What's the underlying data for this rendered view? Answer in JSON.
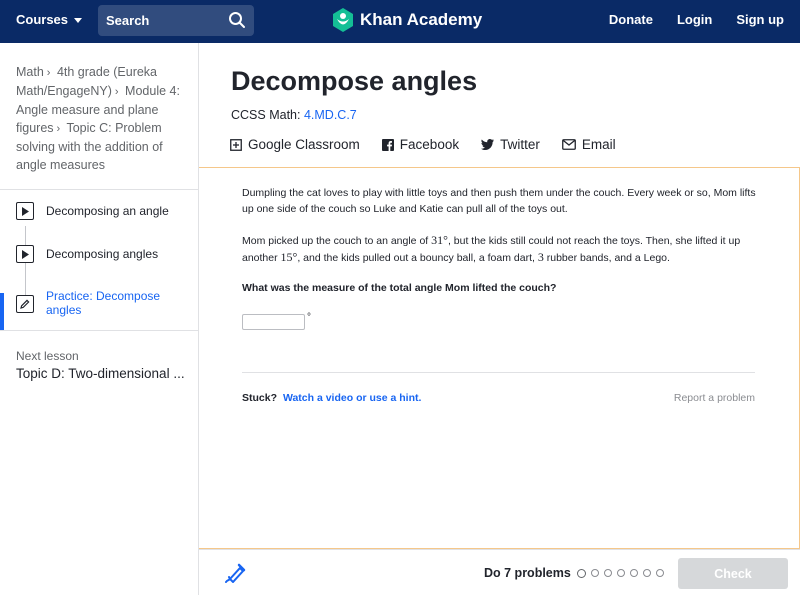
{
  "topbar": {
    "courses_label": "Courses",
    "search_label": "Search",
    "brand_name": "Khan Academy",
    "nav": [
      "Donate",
      "Login",
      "Sign up"
    ]
  },
  "sidebar": {
    "breadcrumb": [
      "Math",
      "4th grade (Eureka Math/EngageNY)",
      "Module 4: Angle measure and plane figures",
      "Topic C: Problem solving with the addition of angle measures"
    ],
    "items": [
      {
        "label": "Decomposing an angle",
        "icon": "play-icon"
      },
      {
        "label": "Decomposing angles",
        "icon": "play-icon"
      },
      {
        "label": "Practice: Decompose angles",
        "icon": "pencil-icon"
      }
    ],
    "next_lesson_label": "Next lesson",
    "next_lesson_title": "Topic D: Two-dimensional ..."
  },
  "header": {
    "title": "Decompose angles",
    "ccss_label": "CCSS Math:",
    "ccss_code": "4.MD.C.7",
    "share": [
      "Google Classroom",
      "Facebook",
      "Twitter",
      "Email"
    ]
  },
  "exercise": {
    "paragraph1": "Dumpling the cat loves to play with little toys and then push them under the couch. Every week or so, Mom lifts up one side of the couch so Luke and Katie can pull all of the toys out.",
    "p2_a": "Mom picked up the couch to an angle of ",
    "p2_angle1": "31°",
    "p2_b": ", but the kids still could not reach the toys. Then, she lifted it up another ",
    "p2_angle2": "15°",
    "p2_c": ", and the kids pulled out a bouncy ball, a foam dart, ",
    "p2_num": "3",
    "p2_d": " rubber bands, and a Lego.",
    "prompt": "What was the measure of the total angle Mom lifted the couch?",
    "answer_value": "",
    "degree_symbol": "°",
    "stuck_label": "Stuck?",
    "stuck_link": "Watch a video or use a hint.",
    "report": "Report a problem"
  },
  "footer": {
    "do_label": "Do 7 problems",
    "problem_count": 7,
    "check_label": "Check"
  },
  "colors": {
    "navy": "#0a2a66",
    "accent_blue": "#1865f2",
    "exercise_border": "#f5c78a",
    "check_disabled": "#d6d8da"
  }
}
